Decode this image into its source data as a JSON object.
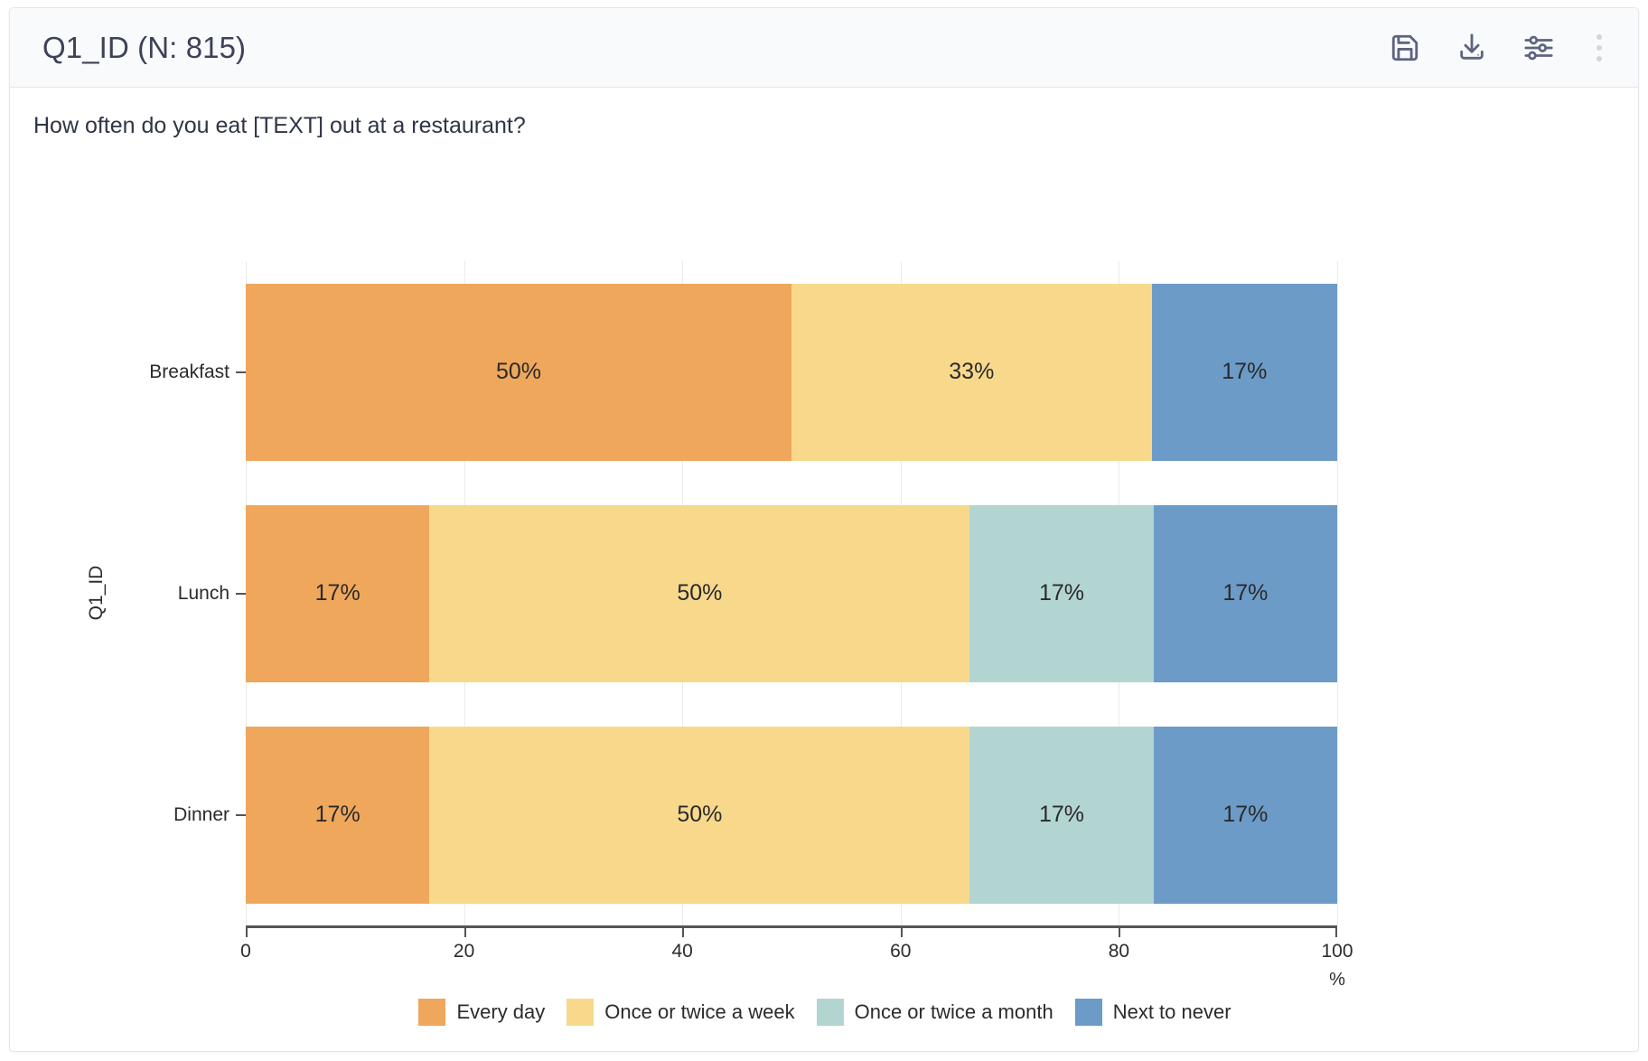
{
  "header": {
    "title": "Q1_ID (N: 815)",
    "actions": [
      {
        "name": "save-button",
        "icon": "save-icon",
        "label": "Save"
      },
      {
        "name": "download-button",
        "icon": "download-icon",
        "label": "Download"
      },
      {
        "name": "settings-button",
        "icon": "sliders-icon",
        "label": "Settings"
      },
      {
        "name": "more-options-button",
        "icon": "kebab-menu-icon",
        "label": "More options"
      }
    ]
  },
  "question": "How often do you eat [TEXT] out at a restaurant?",
  "chart_data": {
    "type": "bar",
    "orientation": "horizontal",
    "stacked": true,
    "title": "",
    "subtitle": "How often do you eat [TEXT] out at a restaurant?",
    "xlabel": "%",
    "ylabel": "Q1_ID",
    "xlim": [
      0,
      100
    ],
    "xticks": [
      0,
      20,
      40,
      60,
      80,
      100
    ],
    "xtick_labels": [
      "0",
      "20",
      "40",
      "60",
      "80",
      "100"
    ],
    "grid": true,
    "legend_position": "bottom",
    "categories": [
      "Breakfast",
      "Lunch",
      "Dinner"
    ],
    "series": [
      {
        "name": "Every day",
        "color": "#efa75c",
        "values": [
          50,
          17,
          17
        ],
        "labels": [
          "50%",
          "17%",
          "17%"
        ]
      },
      {
        "name": "Once or twice a week",
        "color": "#f8d98c",
        "values": [
          33,
          50,
          50
        ],
        "labels": [
          "33%",
          "50%",
          "50%"
        ]
      },
      {
        "name": "Once or twice a month",
        "color": "#b2d5d2",
        "values": [
          0,
          17,
          17
        ],
        "labels": [
          "",
          "17%",
          "17%"
        ]
      },
      {
        "name": "Next to never",
        "color": "#6c9bc8",
        "values": [
          17,
          17,
          17
        ],
        "labels": [
          "17%",
          "17%",
          "17%"
        ]
      }
    ]
  }
}
